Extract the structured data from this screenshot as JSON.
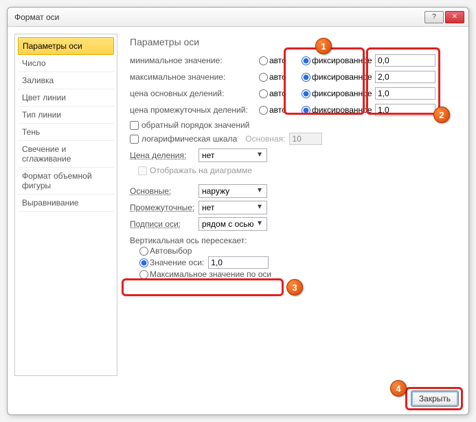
{
  "title": "Формат оси",
  "sidebar": {
    "items": [
      "Параметры оси",
      "Число",
      "Заливка",
      "Цвет линии",
      "Тип линии",
      "Тень",
      "Свечение и сглаживание",
      "Формат объемной фигуры",
      "Выравнивание"
    ]
  },
  "main": {
    "heading": "Параметры оси",
    "rows": [
      {
        "label": "минимальное значение:",
        "value": "0,0"
      },
      {
        "label": "максимальное значение:",
        "value": "2,0"
      },
      {
        "label": "цена основных делений:",
        "value": "1,0"
      },
      {
        "label": "цена промежуточных делений:",
        "value": "1,0"
      }
    ],
    "auto": "авто",
    "fixed": "фиксированное",
    "reverse": "обратный порядок значений",
    "logscale": "логарифмическая шкала",
    "base_label": "Основная:",
    "base_value": "10",
    "unit_label": "Цена деления:",
    "unit_value": "нет",
    "show_on_chart": "Отображать на диаграмме",
    "major_label": "Основные:",
    "major_value": "наружу",
    "minor_label": "Промежуточные:",
    "minor_value": "нет",
    "ticklabels_label": "Подписи оси:",
    "ticklabels_value": "рядом с осью",
    "cross_header": "Вертикальная ось пересекает:",
    "cross_auto": "Автовыбор",
    "cross_value_label": "Значение оси:",
    "cross_value": "1,0",
    "cross_max": "Максимальное значение по оси"
  },
  "footer": {
    "close": "Закрыть"
  },
  "annotations": {
    "b1": "1",
    "b2": "2",
    "b3": "3",
    "b4": "4"
  }
}
